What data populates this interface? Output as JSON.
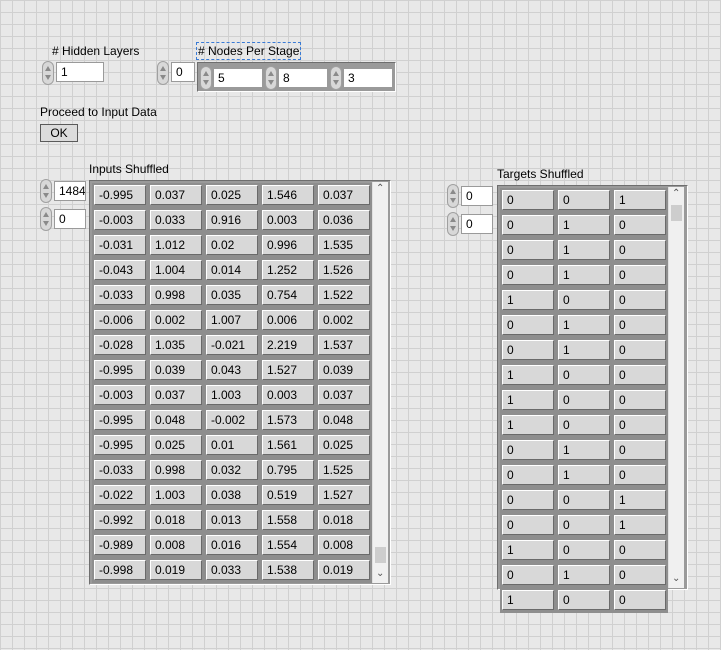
{
  "hidden_layers": {
    "label": "# Hidden Layers",
    "value": "1"
  },
  "nodes_per_stage": {
    "label": "# Nodes Per Stage",
    "index": "0",
    "values": [
      "5",
      "8",
      "3"
    ]
  },
  "proceed": {
    "label": "Proceed to Input Data",
    "button": "OK"
  },
  "inputs": {
    "label": "Inputs Shuffled",
    "row_index": "1484",
    "col_index": "0",
    "rows": [
      [
        "-0.995",
        "0.037",
        "0.025",
        "1.546",
        "0.037"
      ],
      [
        "-0.003",
        "0.033",
        "0.916",
        "0.003",
        "0.036"
      ],
      [
        "-0.031",
        "1.012",
        "0.02",
        "0.996",
        "1.535"
      ],
      [
        "-0.043",
        "1.004",
        "0.014",
        "1.252",
        "1.526"
      ],
      [
        "-0.033",
        "0.998",
        "0.035",
        "0.754",
        "1.522"
      ],
      [
        "-0.006",
        "0.002",
        "1.007",
        "0.006",
        "0.002"
      ],
      [
        "-0.028",
        "1.035",
        "-0.021",
        "2.219",
        "1.537"
      ],
      [
        "-0.995",
        "0.039",
        "0.043",
        "1.527",
        "0.039"
      ],
      [
        "-0.003",
        "0.037",
        "1.003",
        "0.003",
        "0.037"
      ],
      [
        "-0.995",
        "0.048",
        "-0.002",
        "1.573",
        "0.048"
      ],
      [
        "-0.995",
        "0.025",
        "0.01",
        "1.561",
        "0.025"
      ],
      [
        "-0.033",
        "0.998",
        "0.032",
        "0.795",
        "1.525"
      ],
      [
        "-0.022",
        "1.003",
        "0.038",
        "0.519",
        "1.527"
      ],
      [
        "-0.992",
        "0.018",
        "0.013",
        "1.558",
        "0.018"
      ],
      [
        "-0.989",
        "0.008",
        "0.016",
        "1.554",
        "0.008"
      ],
      [
        "-0.998",
        "0.019",
        "0.033",
        "1.538",
        "0.019"
      ]
    ]
  },
  "targets": {
    "label": "Targets Shuffled",
    "row_index": "0",
    "col_index": "0",
    "rows": [
      [
        "0",
        "0",
        "1"
      ],
      [
        "0",
        "1",
        "0"
      ],
      [
        "0",
        "1",
        "0"
      ],
      [
        "0",
        "1",
        "0"
      ],
      [
        "1",
        "0",
        "0"
      ],
      [
        "0",
        "1",
        "0"
      ],
      [
        "0",
        "1",
        "0"
      ],
      [
        "1",
        "0",
        "0"
      ],
      [
        "1",
        "0",
        "0"
      ],
      [
        "1",
        "0",
        "0"
      ],
      [
        "0",
        "1",
        "0"
      ],
      [
        "0",
        "1",
        "0"
      ],
      [
        "0",
        "0",
        "1"
      ],
      [
        "0",
        "0",
        "1"
      ],
      [
        "1",
        "0",
        "0"
      ],
      [
        "0",
        "1",
        "0"
      ],
      [
        "1",
        "0",
        "0"
      ]
    ]
  }
}
